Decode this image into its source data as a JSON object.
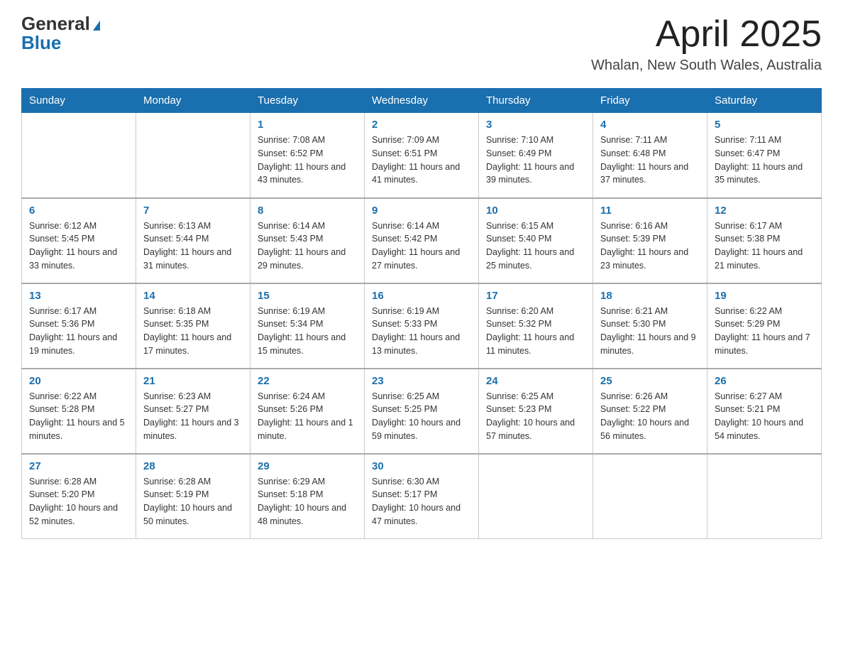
{
  "header": {
    "logo": {
      "general": "General",
      "blue": "Blue"
    },
    "title": "April 2025",
    "subtitle": "Whalan, New South Wales, Australia"
  },
  "weekdays": [
    "Sunday",
    "Monday",
    "Tuesday",
    "Wednesday",
    "Thursday",
    "Friday",
    "Saturday"
  ],
  "weeks": [
    [
      null,
      null,
      {
        "day": 1,
        "sunrise": "7:08 AM",
        "sunset": "6:52 PM",
        "daylight": "11 hours and 43 minutes."
      },
      {
        "day": 2,
        "sunrise": "7:09 AM",
        "sunset": "6:51 PM",
        "daylight": "11 hours and 41 minutes."
      },
      {
        "day": 3,
        "sunrise": "7:10 AM",
        "sunset": "6:49 PM",
        "daylight": "11 hours and 39 minutes."
      },
      {
        "day": 4,
        "sunrise": "7:11 AM",
        "sunset": "6:48 PM",
        "daylight": "11 hours and 37 minutes."
      },
      {
        "day": 5,
        "sunrise": "7:11 AM",
        "sunset": "6:47 PM",
        "daylight": "11 hours and 35 minutes."
      }
    ],
    [
      {
        "day": 6,
        "sunrise": "6:12 AM",
        "sunset": "5:45 PM",
        "daylight": "11 hours and 33 minutes."
      },
      {
        "day": 7,
        "sunrise": "6:13 AM",
        "sunset": "5:44 PM",
        "daylight": "11 hours and 31 minutes."
      },
      {
        "day": 8,
        "sunrise": "6:14 AM",
        "sunset": "5:43 PM",
        "daylight": "11 hours and 29 minutes."
      },
      {
        "day": 9,
        "sunrise": "6:14 AM",
        "sunset": "5:42 PM",
        "daylight": "11 hours and 27 minutes."
      },
      {
        "day": 10,
        "sunrise": "6:15 AM",
        "sunset": "5:40 PM",
        "daylight": "11 hours and 25 minutes."
      },
      {
        "day": 11,
        "sunrise": "6:16 AM",
        "sunset": "5:39 PM",
        "daylight": "11 hours and 23 minutes."
      },
      {
        "day": 12,
        "sunrise": "6:17 AM",
        "sunset": "5:38 PM",
        "daylight": "11 hours and 21 minutes."
      }
    ],
    [
      {
        "day": 13,
        "sunrise": "6:17 AM",
        "sunset": "5:36 PM",
        "daylight": "11 hours and 19 minutes."
      },
      {
        "day": 14,
        "sunrise": "6:18 AM",
        "sunset": "5:35 PM",
        "daylight": "11 hours and 17 minutes."
      },
      {
        "day": 15,
        "sunrise": "6:19 AM",
        "sunset": "5:34 PM",
        "daylight": "11 hours and 15 minutes."
      },
      {
        "day": 16,
        "sunrise": "6:19 AM",
        "sunset": "5:33 PM",
        "daylight": "11 hours and 13 minutes."
      },
      {
        "day": 17,
        "sunrise": "6:20 AM",
        "sunset": "5:32 PM",
        "daylight": "11 hours and 11 minutes."
      },
      {
        "day": 18,
        "sunrise": "6:21 AM",
        "sunset": "5:30 PM",
        "daylight": "11 hours and 9 minutes."
      },
      {
        "day": 19,
        "sunrise": "6:22 AM",
        "sunset": "5:29 PM",
        "daylight": "11 hours and 7 minutes."
      }
    ],
    [
      {
        "day": 20,
        "sunrise": "6:22 AM",
        "sunset": "5:28 PM",
        "daylight": "11 hours and 5 minutes."
      },
      {
        "day": 21,
        "sunrise": "6:23 AM",
        "sunset": "5:27 PM",
        "daylight": "11 hours and 3 minutes."
      },
      {
        "day": 22,
        "sunrise": "6:24 AM",
        "sunset": "5:26 PM",
        "daylight": "11 hours and 1 minute."
      },
      {
        "day": 23,
        "sunrise": "6:25 AM",
        "sunset": "5:25 PM",
        "daylight": "10 hours and 59 minutes."
      },
      {
        "day": 24,
        "sunrise": "6:25 AM",
        "sunset": "5:23 PM",
        "daylight": "10 hours and 57 minutes."
      },
      {
        "day": 25,
        "sunrise": "6:26 AM",
        "sunset": "5:22 PM",
        "daylight": "10 hours and 56 minutes."
      },
      {
        "day": 26,
        "sunrise": "6:27 AM",
        "sunset": "5:21 PM",
        "daylight": "10 hours and 54 minutes."
      }
    ],
    [
      {
        "day": 27,
        "sunrise": "6:28 AM",
        "sunset": "5:20 PM",
        "daylight": "10 hours and 52 minutes."
      },
      {
        "day": 28,
        "sunrise": "6:28 AM",
        "sunset": "5:19 PM",
        "daylight": "10 hours and 50 minutes."
      },
      {
        "day": 29,
        "sunrise": "6:29 AM",
        "sunset": "5:18 PM",
        "daylight": "10 hours and 48 minutes."
      },
      {
        "day": 30,
        "sunrise": "6:30 AM",
        "sunset": "5:17 PM",
        "daylight": "10 hours and 47 minutes."
      },
      null,
      null,
      null
    ]
  ]
}
